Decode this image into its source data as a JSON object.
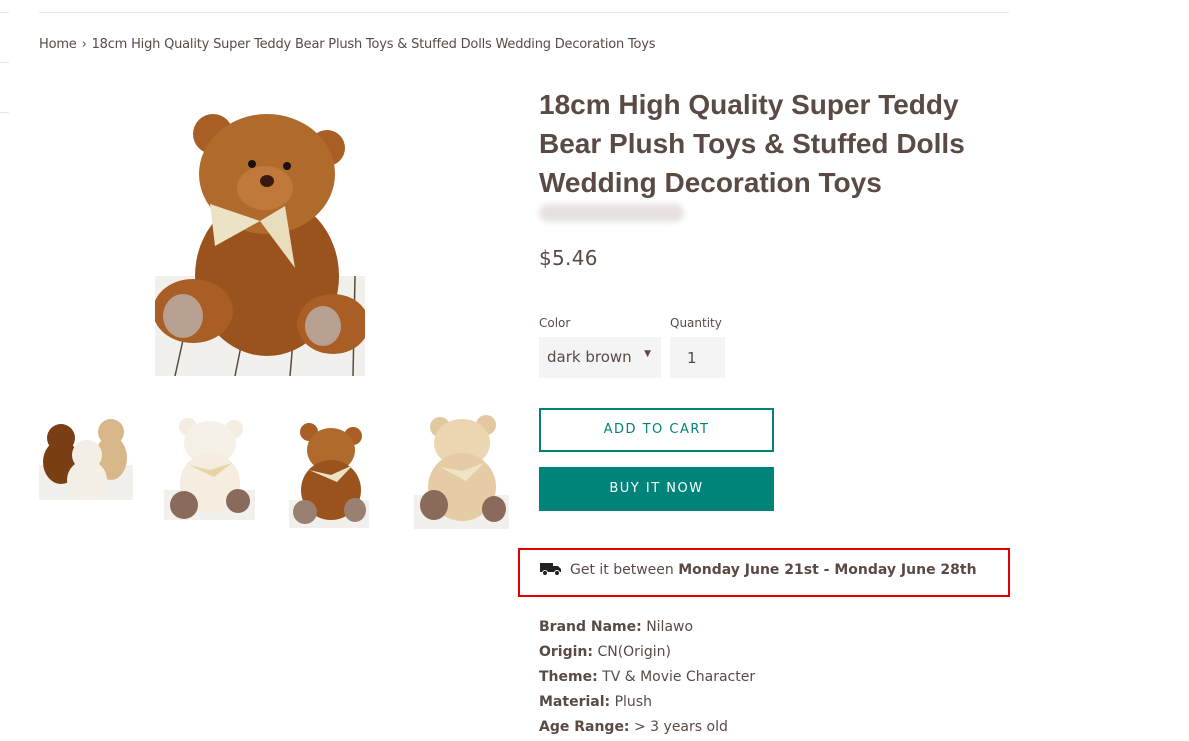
{
  "breadcrumb": {
    "home": "Home",
    "separator": "›",
    "current": "18cm High Quality Super Teddy Bear Plush Toys & Stuffed Dolls Wedding Decoration Toys"
  },
  "product": {
    "title": "18cm High Quality Super Teddy Bear Plush Toys & Stuffed Dolls Wedding Decoration Toys",
    "price": "$5.46",
    "main_image": "teddy-bear-dark-brown",
    "thumbnails": [
      {
        "name": "three-bears-group"
      },
      {
        "name": "white-bear"
      },
      {
        "name": "dark-brown-bear"
      },
      {
        "name": "light-beige-bear"
      }
    ]
  },
  "options": {
    "color_label": "Color",
    "color_value": "dark brown",
    "quantity_label": "Quantity",
    "quantity_value": "1"
  },
  "actions": {
    "add_to_cart": "ADD TO CART",
    "buy_now": "BUY IT NOW"
  },
  "delivery": {
    "icon": "truck-icon",
    "prefix": "Get it between",
    "range": "Monday June 21st - Monday June 28th"
  },
  "specs": [
    {
      "key": "Brand Name:",
      "value": "Nilawo"
    },
    {
      "key": "Origin:",
      "value": "CN(Origin)"
    },
    {
      "key": "Theme:",
      "value": "TV & Movie Character"
    },
    {
      "key": "Material:",
      "value": "Plush"
    },
    {
      "key": "Age Range:",
      "value": "> 3 years old"
    }
  ],
  "colors": {
    "accent": "#00847a",
    "text": "#5a4a44",
    "highlight_border": "#e00000"
  }
}
